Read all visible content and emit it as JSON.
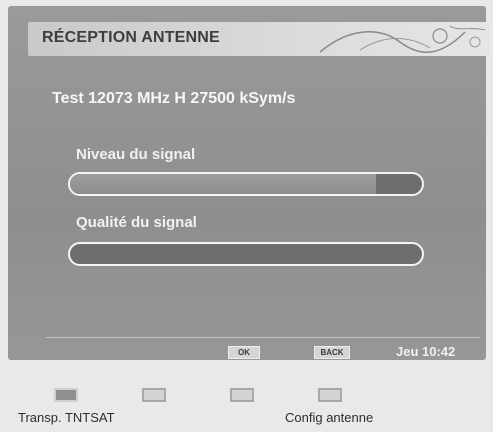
{
  "header": {
    "title": "RÉCEPTION ANTENNE"
  },
  "test_line": "Test 12073 MHz H 27500 kSym/s",
  "signal_level": {
    "label": "Niveau du signal",
    "level": 0.87
  },
  "signal_quality": {
    "label": "Qualité du signal",
    "level": 0.0
  },
  "footer": {
    "ok_key": "OK",
    "back_key": "BACK",
    "clock": "Jeu 10:42"
  },
  "function_keys": {
    "red_label": "Transp. TNTSAT",
    "blue_label": "Config antenne"
  }
}
